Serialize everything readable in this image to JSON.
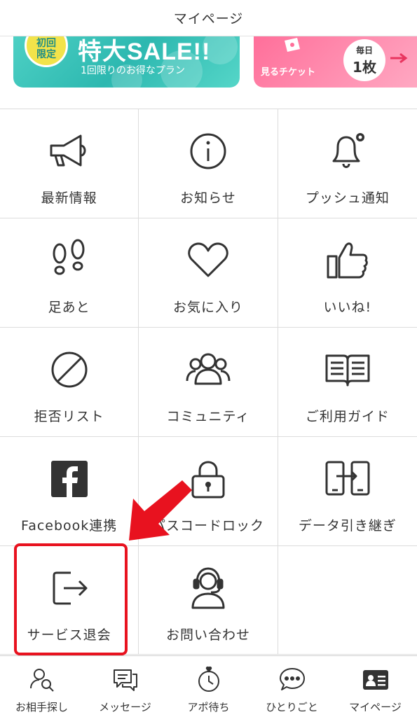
{
  "header": {
    "title": "マイページ"
  },
  "banners": {
    "sale": {
      "badge_line1": "初回",
      "badge_line2": "限定",
      "title": "特大SALE!!",
      "subtitle": "1回限りのお得なプラン"
    },
    "ticket": {
      "label": "見るチケット",
      "daily_line1": "毎日",
      "daily_line2": "1枚"
    }
  },
  "menu": {
    "items": [
      {
        "label": "最新情報",
        "icon": "megaphone-icon"
      },
      {
        "label": "お知らせ",
        "icon": "info-icon"
      },
      {
        "label": "プッシュ通知",
        "icon": "bell-gear-icon"
      },
      {
        "label": "足あと",
        "icon": "footprints-icon"
      },
      {
        "label": "お気に入り",
        "icon": "heart-icon"
      },
      {
        "label": "いいね!",
        "icon": "thumbs-up-icon"
      },
      {
        "label": "拒否リスト",
        "icon": "block-icon"
      },
      {
        "label": "コミュニティ",
        "icon": "community-icon"
      },
      {
        "label": "ご利用ガイド",
        "icon": "book-icon"
      },
      {
        "label": "Facebook連携",
        "icon": "facebook-icon"
      },
      {
        "label": "パスコードロック",
        "icon": "lock-icon"
      },
      {
        "label": "データ引き継ぎ",
        "icon": "data-transfer-icon"
      },
      {
        "label": "サービス退会",
        "icon": "logout-icon"
      },
      {
        "label": "お問い合わせ",
        "icon": "support-headset-icon"
      }
    ]
  },
  "tabbar": {
    "items": [
      {
        "label": "お相手探し",
        "icon": "search-person-icon"
      },
      {
        "label": "メッセージ",
        "icon": "message-icon"
      },
      {
        "label": "アポ待ち",
        "icon": "clock-heart-icon"
      },
      {
        "label": "ひとりごと",
        "icon": "speech-dots-icon"
      },
      {
        "label": "マイページ",
        "icon": "id-card-icon"
      }
    ]
  },
  "colors": {
    "highlight": "#e8121f",
    "sale_teal": "#2db8b0",
    "ticket_pink": "#ff6f9a",
    "icon": "#333333"
  }
}
